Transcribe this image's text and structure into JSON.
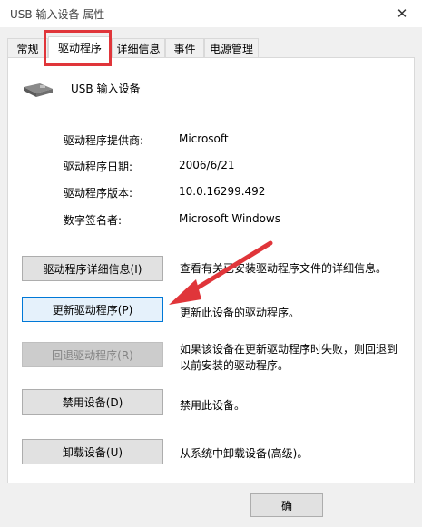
{
  "window": {
    "title": "USB 输入设备 属性",
    "close_glyph": "✕"
  },
  "tabs": [
    {
      "label": "常规"
    },
    {
      "label": "驱动程序",
      "active": true
    },
    {
      "label": "详细信息"
    },
    {
      "label": "事件"
    },
    {
      "label": "电源管理"
    }
  ],
  "device": {
    "name": "USB 输入设备",
    "icon": "usb-device-icon"
  },
  "properties": [
    {
      "label": "驱动程序提供商:",
      "value": "Microsoft"
    },
    {
      "label": "驱动程序日期:",
      "value": "2006/6/21"
    },
    {
      "label": "驱动程序版本:",
      "value": "10.0.16299.492"
    },
    {
      "label": "数字签名者:",
      "value": "Microsoft Windows"
    }
  ],
  "actions": [
    {
      "button": "驱动程序详细信息(I)",
      "description": "查看有关已安装驱动程序文件的详细信息。"
    },
    {
      "button": "更新驱动程序(P)",
      "description": "更新此设备的驱动程序。"
    },
    {
      "button": "回退驱动程序(R)",
      "description": "如果该设备在更新驱动程序时失败，则回退到以前安装的驱动程序。"
    },
    {
      "button": "禁用设备(D)",
      "description": "禁用此设备。"
    },
    {
      "button": "卸载设备(U)",
      "description": "从系统中卸载设备(高级)。"
    }
  ],
  "footer": {
    "ok_label": "确"
  },
  "colors": {
    "highlight": "#e0353a",
    "focus": "#0078d7"
  }
}
